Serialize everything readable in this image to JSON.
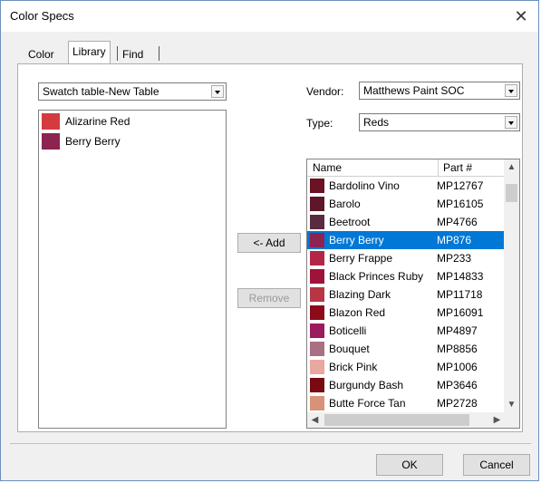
{
  "window": {
    "title": "Color Specs"
  },
  "tabs": [
    {
      "label": "Color"
    },
    {
      "label": "Library"
    },
    {
      "label": "Find"
    }
  ],
  "swatch_table": {
    "selected": "Swatch table-New Table"
  },
  "swatches": [
    {
      "name": "Alizarine Red",
      "color": "#d43a3f"
    },
    {
      "name": "Berry Berry",
      "color": "#8c2350"
    }
  ],
  "vendor": {
    "label": "Vendor:",
    "value": "Matthews Paint SOC"
  },
  "type": {
    "label": "Type:",
    "value": "Reds"
  },
  "buttons": {
    "add": "<- Add",
    "remove": "Remove",
    "ok": "OK",
    "cancel": "Cancel"
  },
  "colors_table": {
    "headers": [
      "Name",
      "Part #"
    ],
    "rows": [
      {
        "name": "Bardolino Vino",
        "part": "MP12767",
        "color": "#6b1224"
      },
      {
        "name": "Barolo",
        "part": "MP16105",
        "color": "#5e1629"
      },
      {
        "name": "Beetroot",
        "part": "MP4766",
        "color": "#5a2a3e"
      },
      {
        "name": "Berry Berry",
        "part": "MP876",
        "color": "#8c2350",
        "selected": true
      },
      {
        "name": "Berry Frappe",
        "part": "MP233",
        "color": "#b42648"
      },
      {
        "name": "Black Princes Ruby",
        "part": "MP14833",
        "color": "#9e1438"
      },
      {
        "name": "Blazing Dark",
        "part": "MP11718",
        "color": "#b83545"
      },
      {
        "name": "Blazon Red",
        "part": "MP16091",
        "color": "#8c0a1a"
      },
      {
        "name": "Boticelli",
        "part": "MP4897",
        "color": "#9a1b5e"
      },
      {
        "name": "Bouquet",
        "part": "MP8856",
        "color": "#a87082"
      },
      {
        "name": "Brick Pink",
        "part": "MP1006",
        "color": "#e8a8a0"
      },
      {
        "name": "Burgundy Bash",
        "part": "MP3646",
        "color": "#7a0a12"
      },
      {
        "name": "Butte Force Tan",
        "part": "MP2728",
        "color": "#d89278"
      }
    ]
  }
}
